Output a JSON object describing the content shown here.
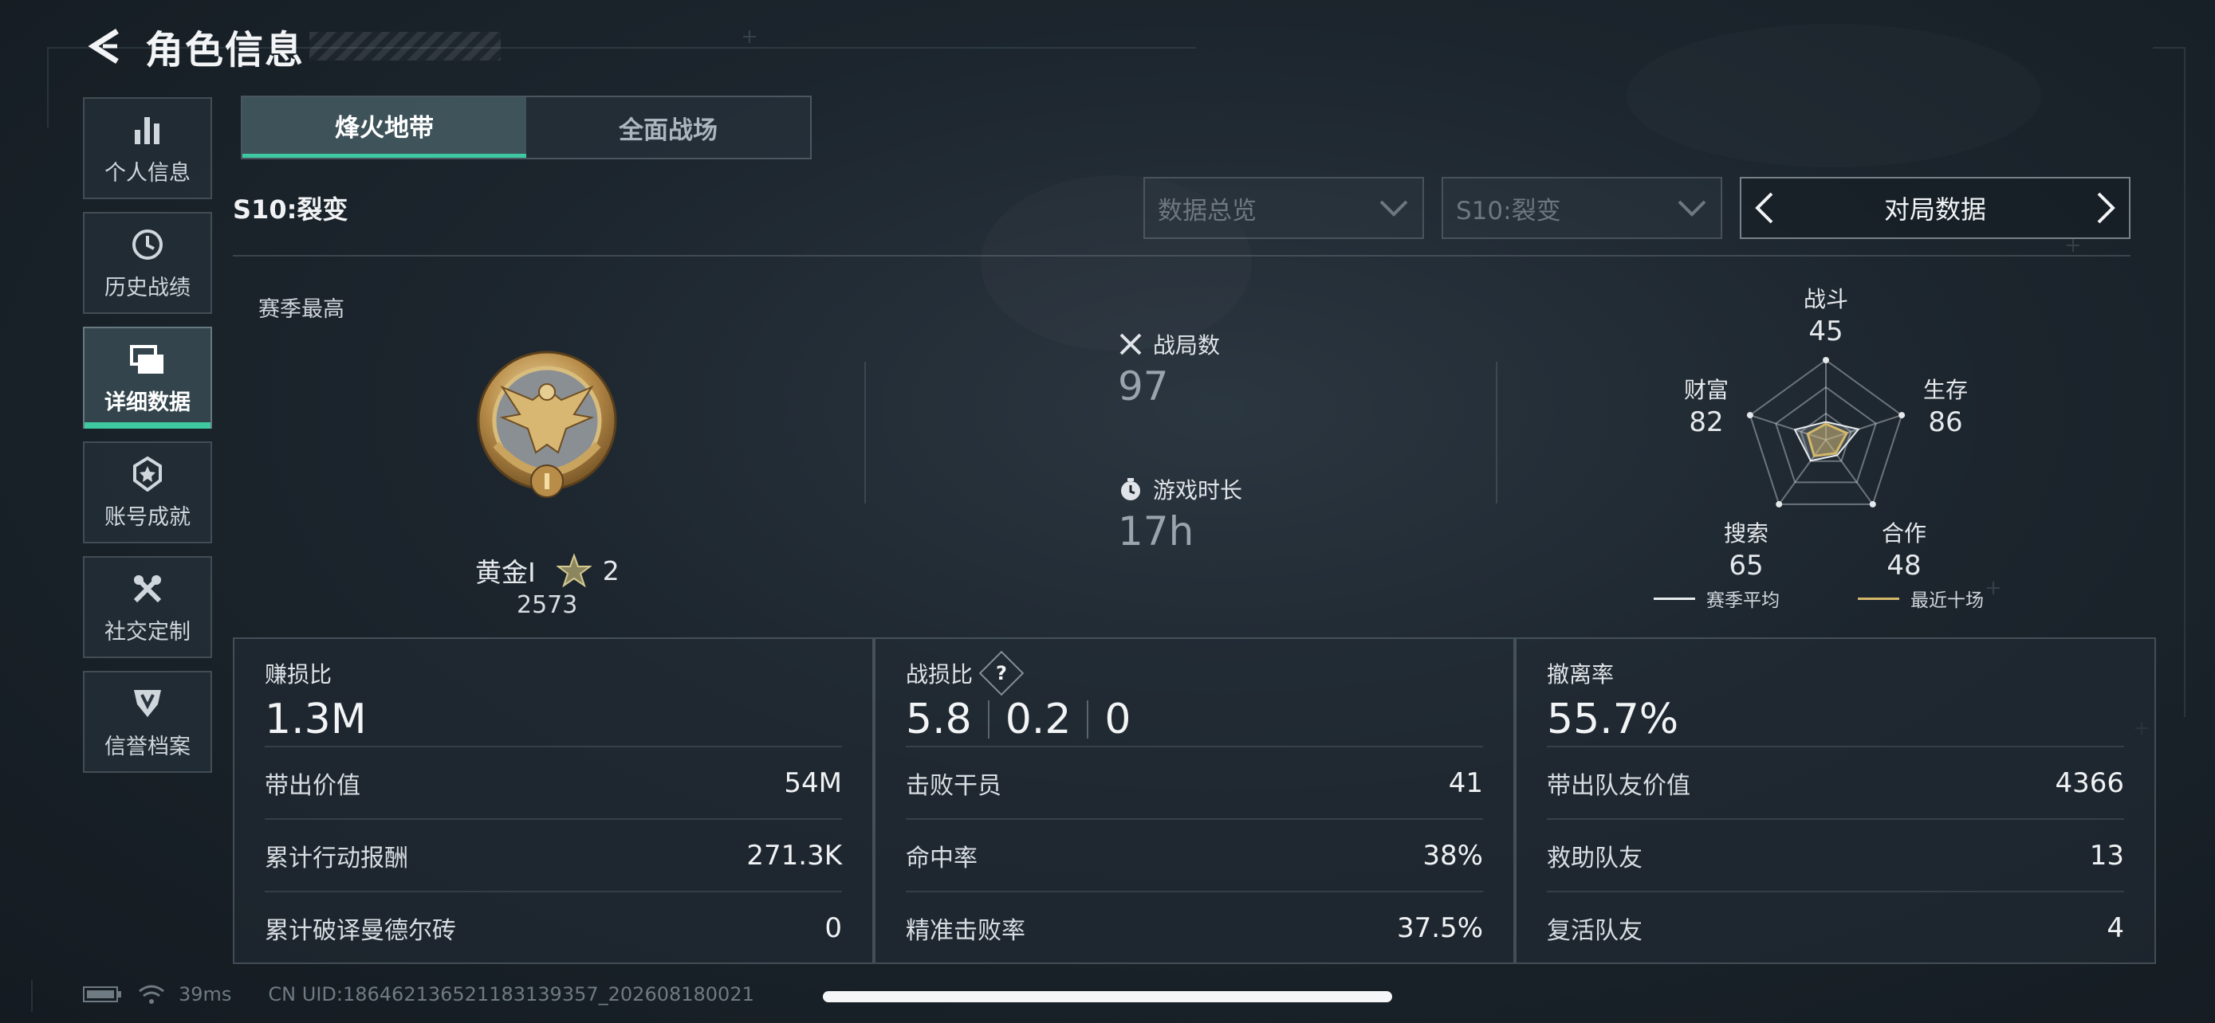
{
  "header": {
    "title": "角色信息"
  },
  "sidebar": {
    "items": [
      {
        "label": "个人信息",
        "icon": "bar-chart-icon"
      },
      {
        "label": "历史战绩",
        "icon": "history-clock-icon"
      },
      {
        "label": "详细数据",
        "icon": "folder-icon",
        "active": true
      },
      {
        "label": "账号成就",
        "icon": "medal-icon"
      },
      {
        "label": "社交定制",
        "icon": "tools-icon"
      },
      {
        "label": "信誉档案",
        "icon": "shield-icon"
      }
    ]
  },
  "tabs": [
    {
      "label": "烽火地带",
      "active": true
    },
    {
      "label": "全面战场",
      "active": false
    }
  ],
  "season": {
    "label": "S10:裂变",
    "dropdown_overview": "数据总览",
    "dropdown_season": "S10:裂变",
    "switcher_label": "对局数据"
  },
  "rank": {
    "heading": "赛季最高",
    "tier": "黄金I",
    "stars": "2",
    "score": "2573",
    "medal_icon": "gold-eagle-medal-icon"
  },
  "match_stats": {
    "matches_label": "战局数",
    "matches_value": "97",
    "playtime_label": "游戏时长",
    "playtime_value": "17h"
  },
  "radar": {
    "axes": [
      {
        "label": "战斗",
        "value": "45"
      },
      {
        "label": "生存",
        "value": "86"
      },
      {
        "label": "合作",
        "value": "48"
      },
      {
        "label": "搜索",
        "value": "65"
      },
      {
        "label": "财富",
        "value": "82"
      }
    ],
    "season_avg": [
      45,
      86,
      48,
      65,
      82
    ],
    "recent_ten": [
      40,
      55,
      42,
      50,
      48
    ],
    "legend_season": "赛季平均",
    "legend_recent": "最近十场",
    "color_season": "#e8ecef",
    "color_recent": "#d4b86a"
  },
  "cards": {
    "profit": {
      "title": "赚损比",
      "main": "1.3M",
      "rows": [
        {
          "label": "带出价值",
          "value": "54M"
        },
        {
          "label": "累计行动报酬",
          "value": "271.3K"
        },
        {
          "label": "累计破译曼德尔砖",
          "value": "0"
        }
      ]
    },
    "combat": {
      "title": "战损比",
      "main": [
        "5.8",
        "0.2",
        "0"
      ],
      "help": "?",
      "rows": [
        {
          "label": "击败干员",
          "value": "41"
        },
        {
          "label": "命中率",
          "value": "38%"
        },
        {
          "label": "精准击败率",
          "value": "37.5%"
        }
      ]
    },
    "extract": {
      "title": "撤离率",
      "main": "55.7%",
      "rows": [
        {
          "label": "带出队友价值",
          "value": "4366"
        },
        {
          "label": "救助队友",
          "value": "13"
        },
        {
          "label": "复活队友",
          "value": "4"
        }
      ]
    }
  },
  "footer": {
    "ping": "39ms",
    "uid": "CN UID:186462136521183139357_202608180021"
  },
  "colors": {
    "accent": "#3ec9a0",
    "gold": "#d4b86a"
  }
}
